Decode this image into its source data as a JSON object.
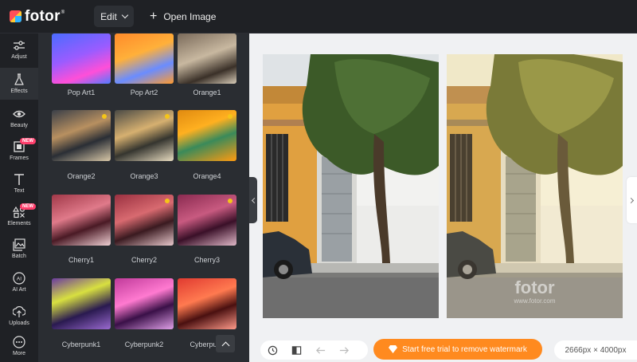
{
  "app": {
    "logo_text": "fotor",
    "logo_reg": "®",
    "edit_label": "Edit",
    "open_image_label": "Open Image"
  },
  "sidebar": {
    "items": [
      {
        "label": "Adjust",
        "icon": "sliders-icon"
      },
      {
        "label": "Effects",
        "icon": "flask-icon",
        "active": true
      },
      {
        "label": "Beauty",
        "icon": "eye-icon"
      },
      {
        "label": "Frames",
        "icon": "frame-icon",
        "badge": "NEW"
      },
      {
        "label": "Text",
        "icon": "text-icon"
      },
      {
        "label": "Elements",
        "icon": "shapes-icon",
        "badge": "NEW"
      },
      {
        "label": "Batch",
        "icon": "image-stack-icon"
      },
      {
        "label": "AI Art",
        "icon": "ai-icon"
      },
      {
        "label": "Uploads",
        "icon": "upload-icon"
      },
      {
        "label": "More",
        "icon": "dots-icon"
      }
    ]
  },
  "effects": {
    "rows": [
      [
        {
          "label": "Pop Art1"
        },
        {
          "label": "Pop Art2"
        },
        {
          "label": "Orange1"
        }
      ],
      [
        {
          "label": "Orange2",
          "premium": true
        },
        {
          "label": "Orange3",
          "premium": true
        },
        {
          "label": "Orange4",
          "premium": true
        }
      ],
      [
        {
          "label": "Cherry1"
        },
        {
          "label": "Cherry2",
          "premium": true
        },
        {
          "label": "Cherry3",
          "premium": true
        }
      ],
      [
        {
          "label": "Cyberpunk1"
        },
        {
          "label": "Cyberpunk2"
        },
        {
          "label": "Cyberpun"
        }
      ]
    ]
  },
  "preview": {
    "watermark_logo": "fotor",
    "watermark_url": "www.fotor.com"
  },
  "toolbar": {
    "trial_label": "Start free trial to remove watermark",
    "dimensions": "2666px × 4000px"
  },
  "colors": {
    "accent": "#ff8a1f",
    "badge": "#ff3e6c",
    "premium_dot": "#f5c518",
    "panel_bg": "#2a2d32",
    "canvas_bg": "#f0f1f3"
  }
}
